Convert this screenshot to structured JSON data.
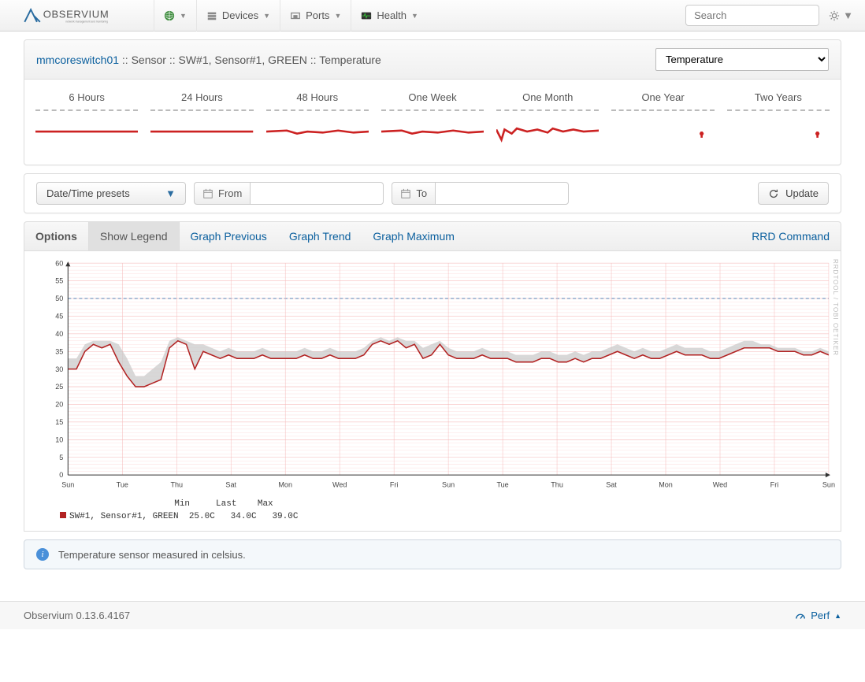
{
  "nav": {
    "devices": "Devices",
    "ports": "Ports",
    "health": "Health",
    "search_placeholder": "Search"
  },
  "breadcrumb": {
    "device": "mmcoreswitch01",
    "rest": ":: Sensor :: SW#1, Sensor#1, GREEN :: Temperature"
  },
  "sensor_select": "Temperature",
  "thumbs": [
    "6 Hours",
    "24 Hours",
    "48 Hours",
    "One Week",
    "One Month",
    "One Year",
    "Two Years"
  ],
  "dt": {
    "presets": "Date/Time presets",
    "from": "From",
    "to": "To",
    "update": "Update"
  },
  "tabs": {
    "options": "Options",
    "show_legend": "Show Legend",
    "graph_previous": "Graph Previous",
    "graph_trend": "Graph Trend",
    "graph_maximum": "Graph Maximum",
    "rrd_command": "RRD Command"
  },
  "chart_data": {
    "type": "line",
    "ylim": [
      0,
      60
    ],
    "yticks": [
      0,
      5,
      10,
      15,
      20,
      25,
      30,
      35,
      40,
      45,
      50,
      55,
      60
    ],
    "threshold": 50,
    "xlabels": [
      "Sun",
      "Tue",
      "Thu",
      "Sat",
      "Mon",
      "Wed",
      "Fri",
      "Sun",
      "Tue",
      "Thu",
      "Sat",
      "Mon",
      "Wed",
      "Fri",
      "Sun"
    ],
    "series": [
      {
        "name": "SW#1, Sensor#1, GREEN",
        "color": "#b22222",
        "values": [
          30,
          30,
          35,
          37,
          36,
          37,
          32,
          28,
          25,
          25,
          26,
          27,
          36,
          38,
          37,
          30,
          35,
          34,
          33,
          34,
          33,
          33,
          33,
          34,
          33,
          33,
          33,
          33,
          34,
          33,
          33,
          34,
          33,
          33,
          33,
          34,
          37,
          38,
          37,
          38,
          36,
          37,
          33,
          34,
          37,
          34,
          33,
          33,
          33,
          34,
          33,
          33,
          33,
          32,
          32,
          32,
          33,
          33,
          32,
          32,
          33,
          32,
          33,
          33,
          34,
          35,
          34,
          33,
          34,
          33,
          33,
          34,
          35,
          34,
          34,
          34,
          33,
          33,
          34,
          35,
          36,
          36,
          36,
          36,
          35,
          35,
          35,
          34,
          34,
          35,
          34
        ],
        "max_band": [
          33,
          33,
          37,
          38,
          38,
          38,
          37,
          33,
          28,
          28,
          30,
          32,
          38,
          39,
          38,
          37,
          37,
          36,
          35,
          36,
          35,
          35,
          35,
          36,
          35,
          35,
          35,
          35,
          36,
          35,
          35,
          36,
          35,
          35,
          35,
          36,
          38,
          39,
          38,
          39,
          38,
          38,
          36,
          37,
          38,
          36,
          35,
          35,
          35,
          36,
          35,
          35,
          35,
          34,
          34,
          34,
          35,
          35,
          34,
          34,
          35,
          34,
          35,
          35,
          36,
          37,
          36,
          35,
          36,
          35,
          35,
          36,
          37,
          36,
          36,
          36,
          35,
          35,
          36,
          37,
          38,
          38,
          37,
          37,
          36,
          36,
          36,
          35,
          35,
          36,
          35
        ]
      }
    ],
    "legend": {
      "header": "                      Min     Last    Max",
      "row": "SW#1, Sensor#1, GREEN  25.0C   34.0C   39.0C"
    },
    "watermark": "RRDTOOL / TOBI OETIKER"
  },
  "info": "Temperature sensor measured in celsius.",
  "footer": {
    "version": "Observium 0.13.6.4167",
    "perf": "Perf"
  }
}
